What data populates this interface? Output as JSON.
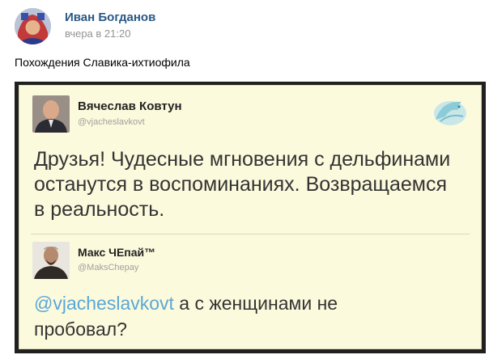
{
  "post": {
    "author": "Иван Богданов",
    "time": "вчера в 21:20",
    "text": "Похождения Славика-ихтиофила"
  },
  "tweets": [
    {
      "name": "Вячеслав Ковтун",
      "handle": "@vjacheslavkovt",
      "line1": "Друзья! Чудесные мгновения с дельфинами",
      "line2": "останутся в воспоминаниях. Возвращаемся",
      "line3": "в реальность."
    },
    {
      "name": "Макс ЧЕпай™",
      "handle": "@MaksChepay",
      "mention": "@vjacheslavkovt",
      "rest": " а с женщинами не",
      "line2": "пробовал?"
    }
  ]
}
